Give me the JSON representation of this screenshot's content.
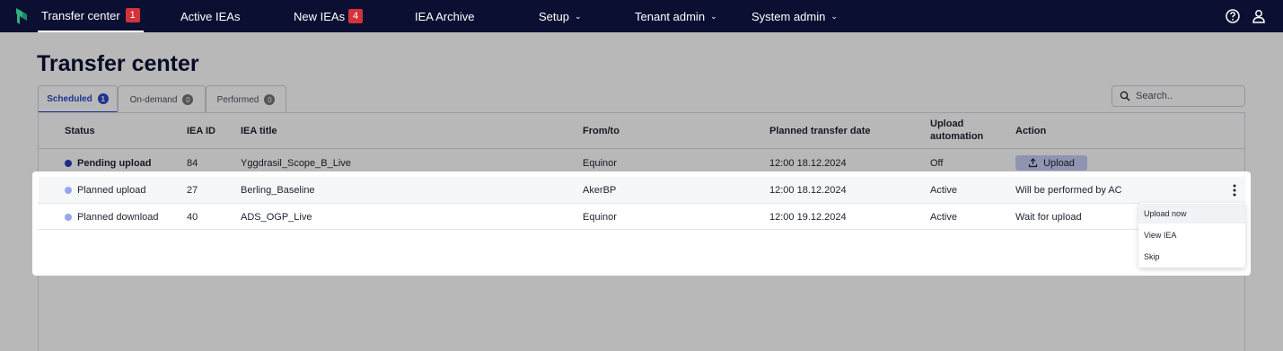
{
  "nav": {
    "items": [
      {
        "label": "Transfer center",
        "badge": "1"
      },
      {
        "label": "Active IEAs"
      },
      {
        "label": "New IEAs",
        "badge": "4"
      },
      {
        "label": "IEA Archive"
      },
      {
        "label": "Setup"
      },
      {
        "label": "Tenant admin"
      },
      {
        "label": "System admin"
      }
    ],
    "icons": [
      "help-icon",
      "user-icon"
    ]
  },
  "page": {
    "title": "Transfer center"
  },
  "tabs": [
    {
      "label": "Scheduled",
      "count": "1",
      "active": true
    },
    {
      "label": "On-demand",
      "count": "0"
    },
    {
      "label": "Performed",
      "count": "0"
    }
  ],
  "search": {
    "placeholder": "Search.."
  },
  "table": {
    "headers": {
      "status": "Status",
      "iea_id": "IEA ID",
      "iea_title": "IEA title",
      "from_to": "From/to",
      "planned_date": "Planned transfer date",
      "upload_automation_1": "Upload",
      "upload_automation_2": "automation",
      "action": "Action"
    },
    "rows": [
      {
        "status": "Pending upload",
        "iea_id": "84",
        "iea_title": "Yggdrasil_Scope_B_Live",
        "from_to": "Equinor",
        "planned_date": "12:00 18.12.2024",
        "automation": "Off",
        "action": "Upload"
      },
      {
        "status": "Planned upload",
        "iea_id": "27",
        "iea_title": "Berling_Baseline",
        "from_to": "AkerBP",
        "planned_date": "12:00 18.12.2024",
        "automation": "Active",
        "action": "Will be performed by AC"
      },
      {
        "status": "Planned download",
        "iea_id": "40",
        "iea_title": "ADS_OGP_Live",
        "from_to": "Equinor",
        "planned_date": "12:00 19.12.2024",
        "automation": "Active",
        "action": "Wait for upload"
      }
    ]
  },
  "colors": {
    "nav_bg": "#0b1033",
    "badge": "#d3333b",
    "status_pending": "#2a3fbf",
    "status_planned": "#98a6f2",
    "upload_button": "#c7cdf5"
  },
  "row_menu": {
    "items": [
      "Upload now",
      "View IEA",
      "Skip"
    ]
  }
}
